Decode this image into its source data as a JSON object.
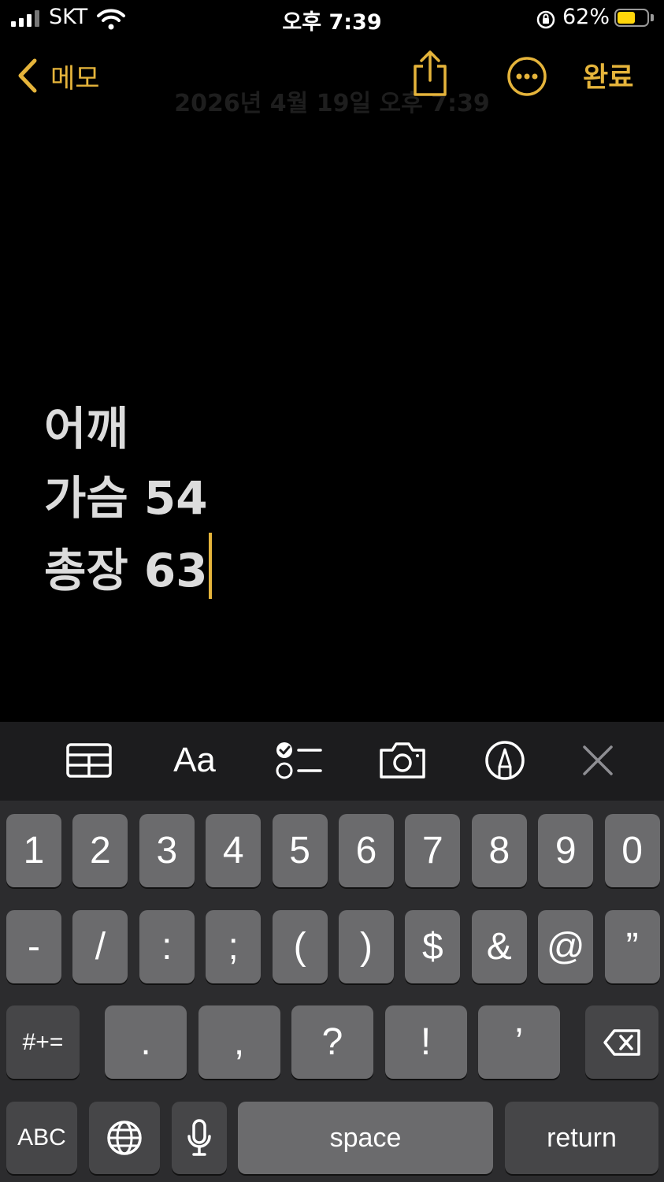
{
  "status_bar": {
    "carrier": "SKT",
    "time": "오후 7:39",
    "battery_percent": "62%",
    "battery_level": 0.62,
    "battery_color": "#ffd60a"
  },
  "nav": {
    "back_label": "메모",
    "done_label": "완료",
    "date_faded": "2026년 4월 19일 오후 7:39",
    "accent_color": "#e5b43b"
  },
  "note": {
    "lines": [
      "어깨",
      "가슴 54",
      "총장 63"
    ]
  },
  "toolbar": {
    "format_label": "Aa",
    "icons": [
      "table-icon",
      "format-icon",
      "checklist-icon",
      "camera-icon",
      "markup-pen-icon",
      "close-icon"
    ]
  },
  "keyboard": {
    "row1": [
      "1",
      "2",
      "3",
      "4",
      "5",
      "6",
      "7",
      "8",
      "9",
      "0"
    ],
    "row2": [
      "-",
      "/",
      ":",
      ";",
      "(",
      ")",
      "$",
      "&",
      "@",
      "”"
    ],
    "row3": [
      ".",
      ",",
      "?",
      "!",
      "’"
    ],
    "symbols_label": "#+=",
    "abc_label": "ABC",
    "space_label": "space",
    "return_label": "return"
  }
}
